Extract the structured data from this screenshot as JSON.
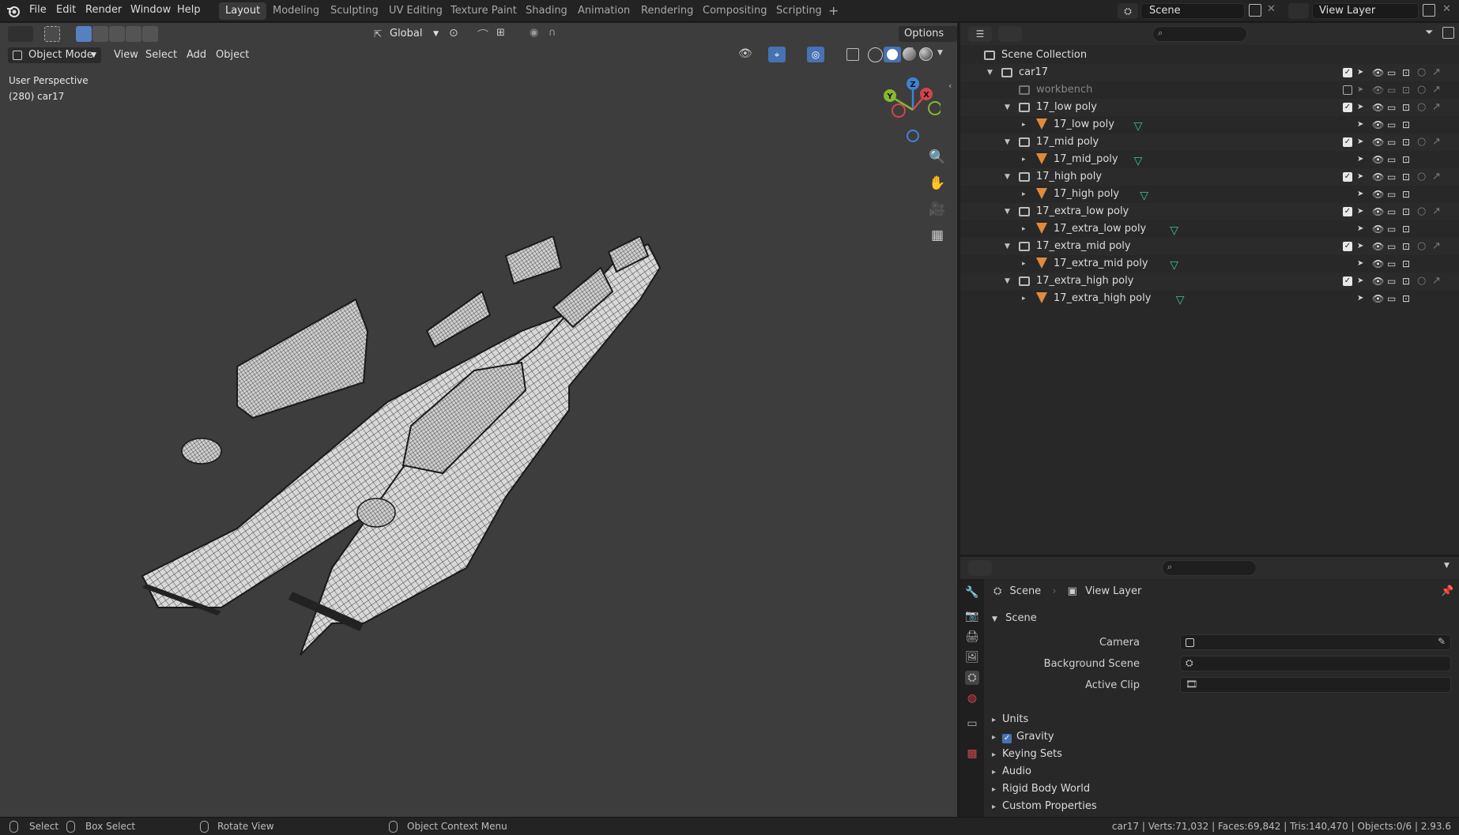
{
  "menu": [
    "File",
    "Edit",
    "Render",
    "Window",
    "Help"
  ],
  "workspaces": [
    {
      "label": "Layout",
      "active": true
    },
    {
      "label": "Modeling",
      "active": false
    },
    {
      "label": "Sculpting",
      "active": false
    },
    {
      "label": "UV Editing",
      "active": false
    },
    {
      "label": "Texture Paint",
      "active": false
    },
    {
      "label": "Shading",
      "active": false
    },
    {
      "label": "Animation",
      "active": false
    },
    {
      "label": "Rendering",
      "active": false
    },
    {
      "label": "Compositing",
      "active": false
    },
    {
      "label": "Scripting",
      "active": false
    }
  ],
  "scene_field": "Scene",
  "view_layer_field": "View Layer",
  "viewport": {
    "transform_orientation": "Global",
    "options_label": "Options",
    "mode": "Object Mode",
    "menus": [
      "View",
      "Select",
      "Add",
      "Object"
    ],
    "perspective_label": "User Perspective",
    "object_info": "(280) car17",
    "gizmo_axes": {
      "x": "X",
      "y": "Y",
      "z": "Z"
    }
  },
  "outliner": {
    "rows": [
      {
        "label": "Scene Collection",
        "kind": "scene",
        "indent": 0,
        "expand": "",
        "dim": false,
        "checkbox": "none",
        "selectable": false,
        "datablock": false,
        "alt": false
      },
      {
        "label": "car17",
        "kind": "collection",
        "indent": 1,
        "expand": "▼",
        "dim": false,
        "checkbox": "on",
        "selectable": true,
        "datablock": false,
        "alt": true
      },
      {
        "label": "workbench",
        "kind": "collection",
        "indent": 2,
        "expand": "",
        "dim": true,
        "checkbox": "off",
        "selectable": true,
        "datablock": false,
        "alt": false
      },
      {
        "label": "17_low poly",
        "kind": "collection",
        "indent": 2,
        "expand": "▼",
        "dim": false,
        "checkbox": "on",
        "selectable": true,
        "datablock": false,
        "alt": true
      },
      {
        "label": "17_low poly",
        "kind": "mesh",
        "indent": 3,
        "expand": "▸",
        "dim": false,
        "checkbox": "none",
        "selectable": true,
        "datablock": true,
        "alt": false
      },
      {
        "label": "17_mid poly",
        "kind": "collection",
        "indent": 2,
        "expand": "▼",
        "dim": false,
        "checkbox": "on",
        "selectable": true,
        "datablock": false,
        "alt": true
      },
      {
        "label": "17_mid_poly",
        "kind": "mesh",
        "indent": 3,
        "expand": "▸",
        "dim": false,
        "checkbox": "none",
        "selectable": true,
        "datablock": true,
        "alt": false
      },
      {
        "label": "17_high poly",
        "kind": "collection",
        "indent": 2,
        "expand": "▼",
        "dim": false,
        "checkbox": "on",
        "selectable": true,
        "datablock": false,
        "alt": true
      },
      {
        "label": "17_high poly",
        "kind": "mesh",
        "indent": 3,
        "expand": "▸",
        "dim": false,
        "checkbox": "none",
        "selectable": true,
        "datablock": true,
        "alt": false
      },
      {
        "label": "17_extra_low poly",
        "kind": "collection",
        "indent": 2,
        "expand": "▼",
        "dim": false,
        "checkbox": "on",
        "selectable": true,
        "datablock": false,
        "alt": true
      },
      {
        "label": "17_extra_low poly",
        "kind": "mesh",
        "indent": 3,
        "expand": "▸",
        "dim": false,
        "checkbox": "none",
        "selectable": true,
        "datablock": true,
        "alt": false
      },
      {
        "label": "17_extra_mid poly",
        "kind": "collection",
        "indent": 2,
        "expand": "▼",
        "dim": false,
        "checkbox": "on",
        "selectable": true,
        "datablock": false,
        "alt": true
      },
      {
        "label": "17_extra_mid poly",
        "kind": "mesh",
        "indent": 3,
        "expand": "▸",
        "dim": false,
        "checkbox": "none",
        "selectable": true,
        "datablock": true,
        "alt": false
      },
      {
        "label": "17_extra_high poly",
        "kind": "collection",
        "indent": 2,
        "expand": "▼",
        "dim": false,
        "checkbox": "on",
        "selectable": true,
        "datablock": false,
        "alt": true
      },
      {
        "label": "17_extra_high poly",
        "kind": "mesh",
        "indent": 3,
        "expand": "▸",
        "dim": false,
        "checkbox": "none",
        "selectable": true,
        "datablock": true,
        "alt": false
      }
    ]
  },
  "properties": {
    "breadcrumb_scene": "Scene",
    "breadcrumb_view_layer": "View Layer",
    "panel_title": "Scene",
    "camera_label": "Camera",
    "background_scene_label": "Background Scene",
    "active_clip_label": "Active Clip",
    "subpanels": [
      "Units",
      "Gravity",
      "Keying Sets",
      "Audio",
      "Rigid Body World",
      "Custom Properties"
    ],
    "gravity_enabled": true
  },
  "statusbar": {
    "select": "Select",
    "box_select": "Box Select",
    "rotate_view": "Rotate View",
    "context_menu": "Object Context Menu",
    "stats": "car17 | Verts:71,032 | Faces:69,842 | Tris:140,470 | Objects:0/6 | 2.93.6"
  },
  "colors": {
    "viewport_bg": "#3d3d3d",
    "panel_bg": "#282828",
    "header_bg": "#232323",
    "mesh_orange": "#e08a3c",
    "mesh_data_teal": "#3fc1a4",
    "gizmo_x": "#d4434f",
    "gizmo_y": "#86b92c",
    "gizmo_z": "#3f83d4"
  }
}
